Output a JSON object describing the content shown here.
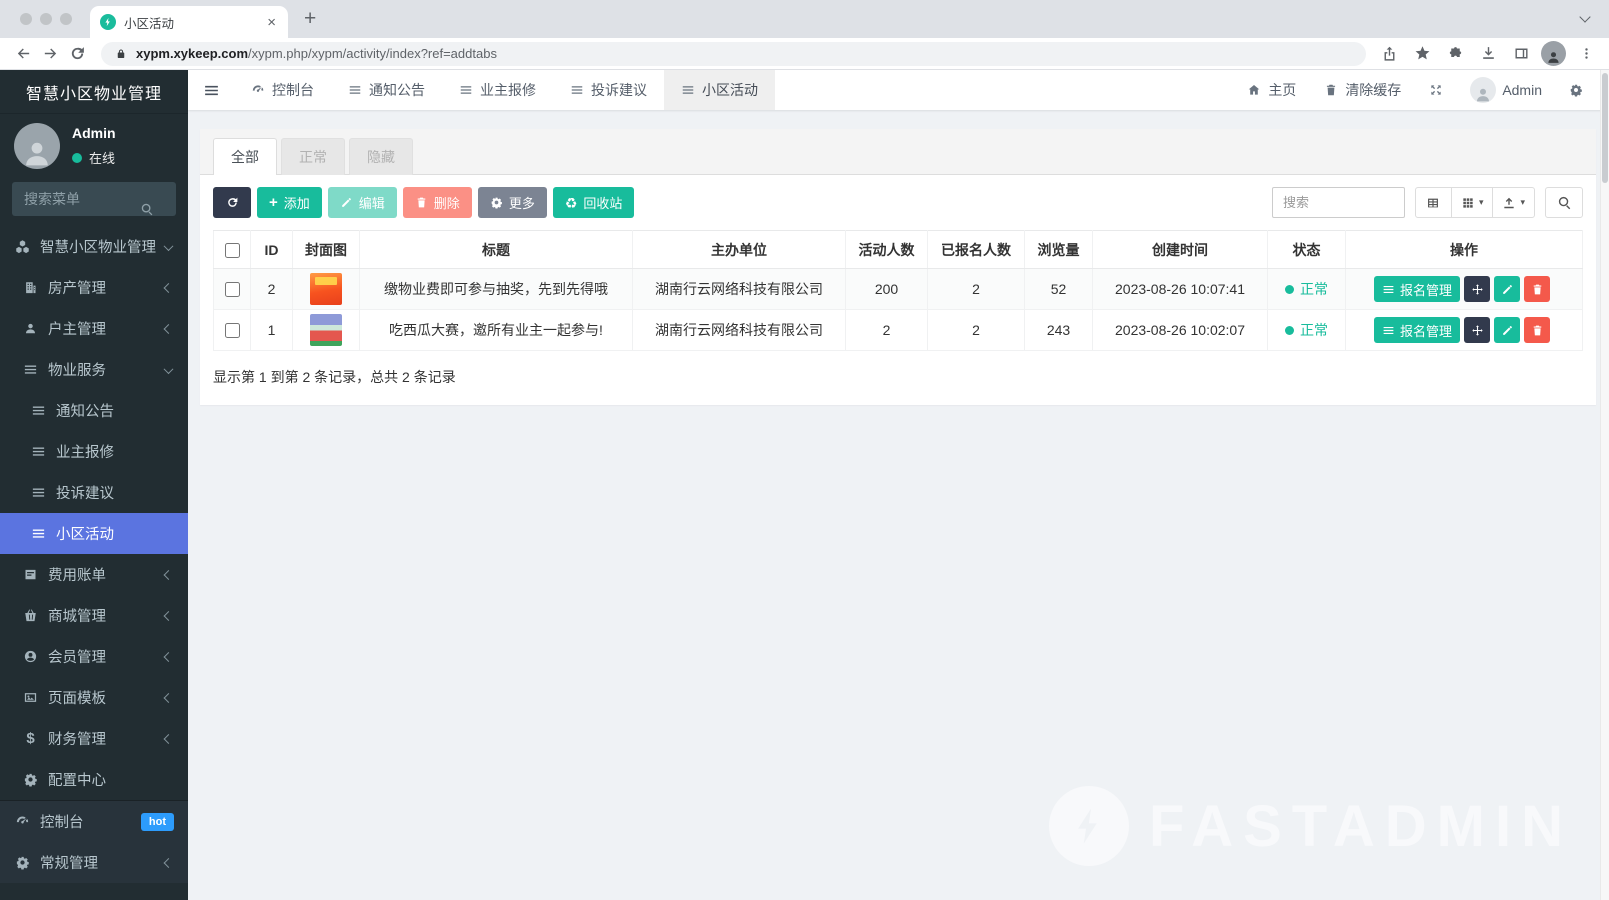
{
  "browser": {
    "tab_title": "小区活动",
    "url_host": "xypm.xykeep.com",
    "url_path": "/xypm.php/xypm/activity/index?ref=addtabs"
  },
  "sidebar": {
    "brand": "智慧小区物业管理",
    "user": {
      "name": "Admin",
      "status_label": "在线"
    },
    "search_placeholder": "搜索菜单",
    "items": [
      {
        "label": "智慧小区物业管理",
        "icon": "cubes",
        "level": 1,
        "chevron": "down"
      },
      {
        "label": "房产管理",
        "icon": "building",
        "level": 2,
        "chevron": "left"
      },
      {
        "label": "户主管理",
        "icon": "person",
        "level": 2,
        "chevron": "left"
      },
      {
        "label": "物业服务",
        "icon": "bars",
        "level": 2,
        "chevron": "down"
      },
      {
        "label": "通知公告",
        "icon": "bars",
        "level": 3
      },
      {
        "label": "业主报修",
        "icon": "bars",
        "level": 3
      },
      {
        "label": "投诉建议",
        "icon": "bars",
        "level": 3
      },
      {
        "label": "小区活动",
        "icon": "bars",
        "level": 3,
        "active": true
      },
      {
        "label": "费用账单",
        "icon": "bill",
        "level": 2,
        "chevron": "left"
      },
      {
        "label": "商城管理",
        "icon": "basket",
        "level": 2,
        "chevron": "left"
      },
      {
        "label": "会员管理",
        "icon": "user-circle",
        "level": 2,
        "chevron": "left"
      },
      {
        "label": "页面模板",
        "icon": "image",
        "level": 2,
        "chevron": "left"
      },
      {
        "label": "财务管理",
        "icon": "dollar",
        "level": 2,
        "chevron": "left"
      },
      {
        "label": "配置中心",
        "icon": "gear",
        "level": 2
      }
    ],
    "bottom_items": [
      {
        "label": "控制台",
        "icon": "gauge",
        "level": 1,
        "badge": "hot"
      },
      {
        "label": "常规管理",
        "icon": "gear",
        "level": 1,
        "chevron": "left"
      }
    ]
  },
  "topnav": {
    "tabs": [
      {
        "label": "控制台",
        "icon": "gauge"
      },
      {
        "label": "通知公告",
        "icon": "bars"
      },
      {
        "label": "业主报修",
        "icon": "bars"
      },
      {
        "label": "投诉建议",
        "icon": "bars"
      },
      {
        "label": "小区活动",
        "icon": "bars",
        "active": true
      }
    ],
    "right": {
      "home_label": "主页",
      "clear_cache_label": "清除缓存",
      "user_name": "Admin"
    }
  },
  "panel": {
    "filter_tabs": [
      {
        "label": "全部",
        "active": true
      },
      {
        "label": "正常"
      },
      {
        "label": "隐藏"
      }
    ],
    "toolbar": {
      "add_label": "添加",
      "edit_label": "编辑",
      "delete_label": "删除",
      "more_label": "更多",
      "recycle_label": "回收站",
      "search_placeholder": "搜索"
    },
    "table": {
      "columns": [
        "ID",
        "封面图",
        "标题",
        "主办单位",
        "活动人数",
        "已报名人数",
        "浏览量",
        "创建时间",
        "状态",
        "操作"
      ],
      "actions": {
        "signup_label": "报名管理"
      },
      "rows": [
        {
          "id": "2",
          "cover": "poster-lottery-orange",
          "title": "缴物业费即可参与抽奖，先到先得哦",
          "organizer": "湖南行云网络科技有限公司",
          "participants": "200",
          "signed_up": "2",
          "views": "52",
          "created_at": "2023-08-26 10:07:41",
          "status": "正常"
        },
        {
          "id": "1",
          "cover": "poster-watermelon",
          "title": "吃西瓜大赛，邀所有业主一起参与!",
          "organizer": "湖南行云网络科技有限公司",
          "participants": "2",
          "signed_up": "2",
          "views": "243",
          "created_at": "2023-08-26 10:02:07",
          "status": "正常"
        }
      ]
    },
    "footer_info": "显示第 1 到第 2 条记录，总共 2 条记录"
  },
  "watermark": {
    "text": "FASTADMIN"
  },
  "colors": {
    "accent_green": "#18bc9c",
    "active_blue": "#5b74e0",
    "danger_red": "#f4594b",
    "dark_navy": "#323a4d",
    "sidebar_bg": "#222d32",
    "hot_badge_blue": "#2d9cfc"
  }
}
